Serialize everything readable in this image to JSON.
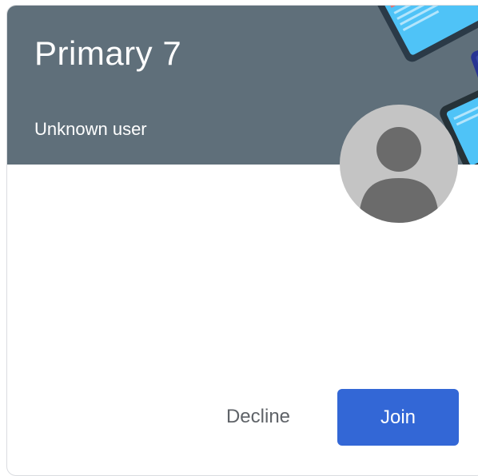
{
  "card": {
    "class_name": "Primary 7",
    "teacher_name": "Unknown user",
    "banner_color": "#5f6f7a",
    "illustration": "phones-devices-illustration",
    "avatar": "default-user-avatar"
  },
  "actions": {
    "decline_label": "Decline",
    "join_label": "Join",
    "join_color": "#3367d6"
  }
}
